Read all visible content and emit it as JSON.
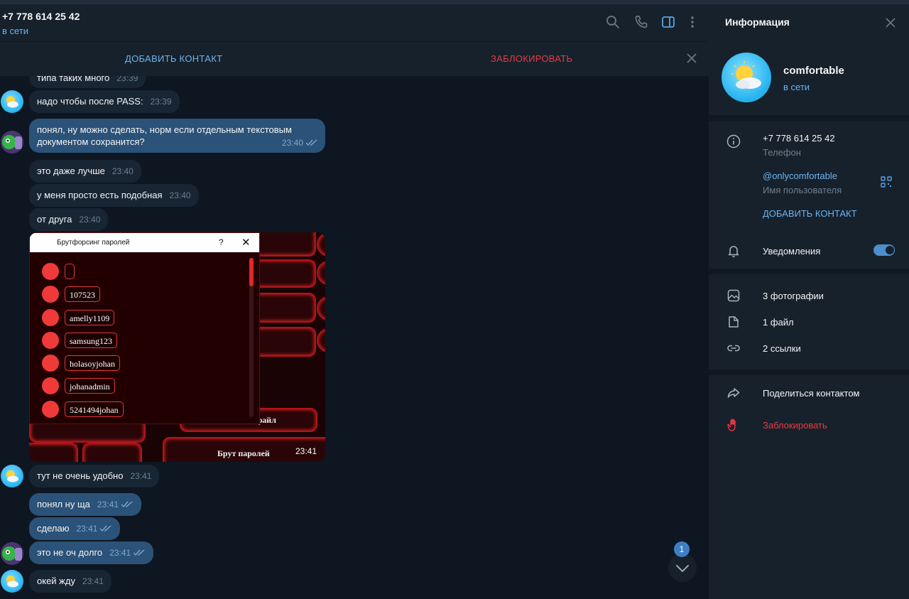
{
  "header": {
    "peer_name": "+7 778 614 25 42",
    "peer_status": "в сети",
    "icons": [
      "search-icon",
      "phone-icon",
      "sidebar-toggle-icon",
      "more-vertical-icon"
    ]
  },
  "action_bar": {
    "add_contact": "ДОБАВИТЬ КОНТАКТ",
    "block": "ЗАБЛОКИРОВАТЬ"
  },
  "messages": [
    {
      "dir": "in",
      "text": "типа таких много",
      "time": "23:39"
    },
    {
      "dir": "in",
      "text": "надо чтобы после PASS:",
      "time": "23:39"
    },
    {
      "dir": "out",
      "text": "понял, ну можно сделать, норм если отдельным текстовым документом сохранится?",
      "time": "23:40"
    },
    {
      "dir": "in",
      "text": "это даже лучше",
      "time": "23:40"
    },
    {
      "dir": "in",
      "text": "у меня просто есть подобная",
      "time": "23:40"
    },
    {
      "dir": "in",
      "text": "от друга",
      "time": "23:40"
    },
    {
      "dir": "in",
      "text": "тут не очень удобно",
      "time": "23:41"
    },
    {
      "dir": "out",
      "text": "понял ну ща",
      "time": "23:41"
    },
    {
      "dir": "out",
      "text": "сделаю",
      "time": "23:41"
    },
    {
      "dir": "out",
      "text": "это не оч долго",
      "time": "23:41"
    },
    {
      "dir": "in",
      "text": "окей жду",
      "time": "23:41"
    }
  ],
  "photo": {
    "dialog_title": "Брутфорсинг паролей",
    "help": "?",
    "close": "✕",
    "items": [
      "",
      "107523",
      "amelly1109",
      "samsung123",
      "holasoyjohan",
      "johanadmin",
      "5241494johan"
    ],
    "label_file": "файл",
    "label_brute": "Брут паролей",
    "time": "23:41"
  },
  "scroll_down": {
    "unread_count": "1"
  },
  "panel": {
    "title": "Информация",
    "name": "comfortable",
    "status": "в сети",
    "phone": "+7 778 614 25 42",
    "phone_label": "Телефон",
    "username": "@onlycomfortable",
    "username_label": "Имя пользователя",
    "add_contact": "ДОБАВИТЬ КОНТАКТ",
    "notifications": "Уведомления",
    "notifications_on": true,
    "photos": "3 фотографии",
    "files": "1 файл",
    "links": "2 ссылки",
    "share": "Поделиться контактом",
    "block": "Заблокировать"
  },
  "colors": {
    "accent": "#6ab3f3",
    "danger": "#ec3942",
    "bubble_out": "#2b5278",
    "bubble_in": "#182533",
    "panel_bg": "#17212b",
    "chat_bg": "#0e1621"
  }
}
